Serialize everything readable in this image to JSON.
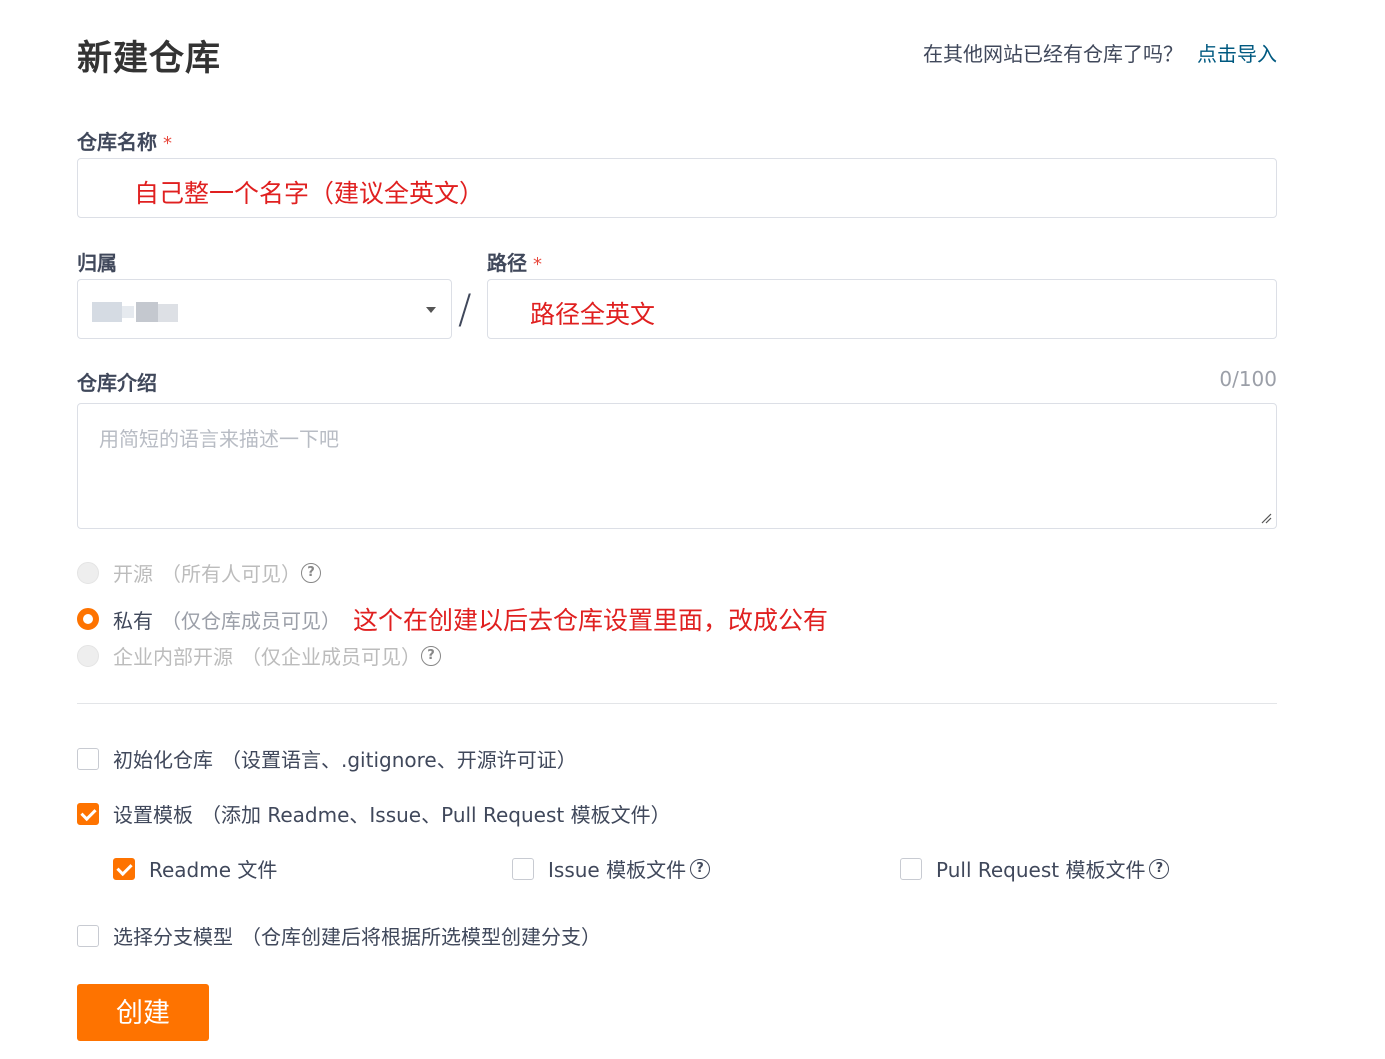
{
  "header": {
    "title": "新建仓库",
    "import_prompt": "在其他网站已经有仓库了吗？",
    "import_link": "点击导入"
  },
  "repo_name": {
    "label": "仓库名称",
    "required_mark": "*",
    "annotation": "自己整一个名字（建议全英文）"
  },
  "owner": {
    "label": "归属",
    "selected_value": "",
    "icon": "caret-down-icon"
  },
  "separator": "/",
  "path": {
    "label": "路径",
    "required_mark": "*",
    "annotation": "路径全英文"
  },
  "description": {
    "label": "仓库介绍",
    "counter": "0/100",
    "placeholder": "用简短的语言来描述一下吧"
  },
  "visibility": {
    "options": [
      {
        "label": "开源",
        "note": "（所有人可见）",
        "help": "?",
        "selected": false,
        "disabled": true
      },
      {
        "label": "私有",
        "note": "（仅仓库成员可见）",
        "selected": true,
        "disabled": false
      },
      {
        "label": "企业内部开源",
        "note": "（仅企业成员可见）",
        "help": "?",
        "selected": false,
        "disabled": true
      }
    ],
    "annotation": "这个在创建以后去仓库设置里面，改成公有"
  },
  "init_repo": {
    "label": "初始化仓库",
    "note": "（设置语言、.gitignore、开源许可证）",
    "checked": false
  },
  "template": {
    "label": "设置模板",
    "note": "（添加 Readme、Issue、Pull Request 模板文件）",
    "checked": true,
    "items": [
      {
        "label": "Readme 文件",
        "checked": true
      },
      {
        "label": "Issue 模板文件",
        "help": "?",
        "checked": false
      },
      {
        "label": "Pull Request 模板文件",
        "help": "?",
        "checked": false
      }
    ]
  },
  "branch_model": {
    "label": "选择分支模型",
    "note": "（仓库创建后将根据所选模型创建分支）",
    "checked": false
  },
  "submit": {
    "label": "创建"
  },
  "colors": {
    "accent": "#fe7300",
    "link": "#005980",
    "annotation": "#e02020"
  }
}
